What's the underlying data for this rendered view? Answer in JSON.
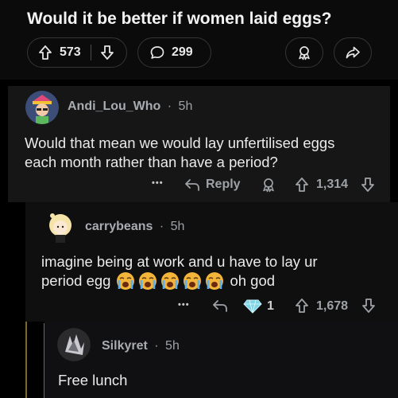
{
  "post": {
    "title": "Would it be better if women laid eggs?",
    "upvotes": "573",
    "comments": "299"
  },
  "comments": [
    {
      "author": "Andi_Lou_Who",
      "time": "5h",
      "body_lines": [
        "Would that mean we would lay unfertilised eggs",
        "each month rather than have a period?"
      ],
      "reply_label": "Reply",
      "votes": "1,314"
    },
    {
      "author": "carrybeans",
      "time": "5h",
      "body_lines": [
        "imagine being at work and u have to lay ur",
        "period egg",
        "oh god"
      ],
      "award_count": "1",
      "votes": "1,678"
    },
    {
      "author": "Silkyret",
      "time": "5h",
      "body": "Free lunch"
    }
  ],
  "separator": "·",
  "more": "•••",
  "icons": {
    "upvote": "upvote-icon",
    "downvote": "downvote-icon",
    "comment": "comment-bubble-icon",
    "award": "award-icon",
    "share": "share-icon",
    "reply": "reply-arrow-icon",
    "diamond": "diamond-award-icon",
    "emoji": "loudly-crying-face-emoji"
  },
  "colors": {
    "accent_thread": "#7a6a32",
    "diamond": "#7fd4e6",
    "emoji": "#f3b43a"
  }
}
